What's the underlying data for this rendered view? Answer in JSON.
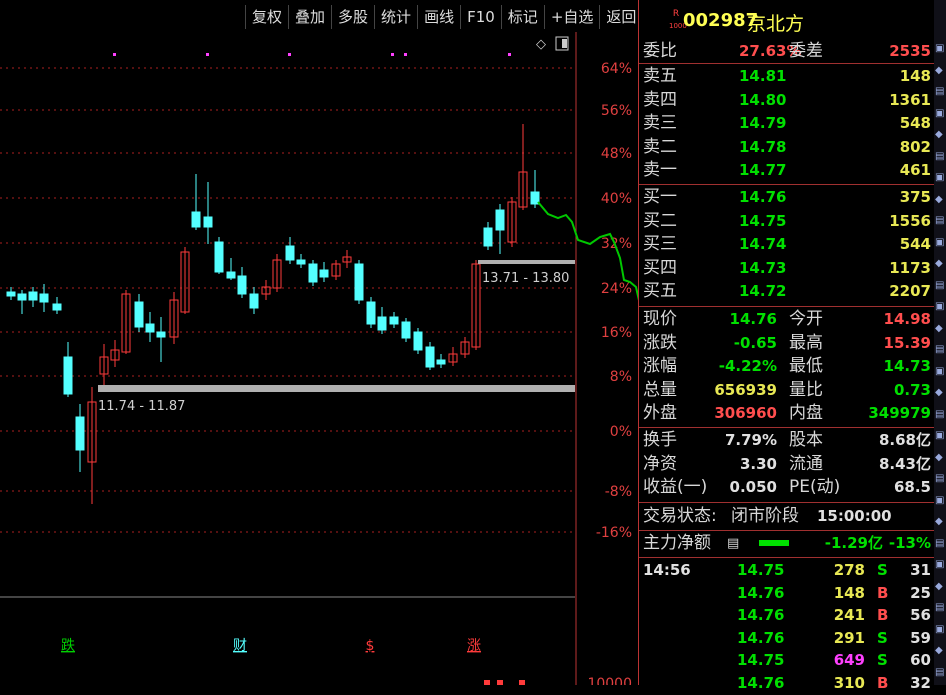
{
  "toolbar": [
    "复权",
    "叠加",
    "多股",
    "统计",
    "画线",
    "F10",
    "标记",
    "+自选",
    "返回"
  ],
  "stock": {
    "code": "002987",
    "name": "京北方",
    "logo": "R",
    "logo_sub": "1000"
  },
  "weibi": {
    "label": "委比",
    "value": "27.63%",
    "label2": "委差",
    "value2": "2535"
  },
  "sell": [
    {
      "label": "卖五",
      "price": "14.81",
      "vol": "148"
    },
    {
      "label": "卖四",
      "price": "14.80",
      "vol": "1361"
    },
    {
      "label": "卖三",
      "price": "14.79",
      "vol": "548"
    },
    {
      "label": "卖二",
      "price": "14.78",
      "vol": "802"
    },
    {
      "label": "卖一",
      "price": "14.77",
      "vol": "461"
    }
  ],
  "buy": [
    {
      "label": "买一",
      "price": "14.76",
      "vol": "375"
    },
    {
      "label": "买二",
      "price": "14.75",
      "vol": "1556"
    },
    {
      "label": "买三",
      "price": "14.74",
      "vol": "544"
    },
    {
      "label": "买四",
      "price": "14.73",
      "vol": "1173"
    },
    {
      "label": "买五",
      "price": "14.72",
      "vol": "2207"
    }
  ],
  "stats": [
    {
      "l1": "现价",
      "v1": "14.76",
      "l2": "今开",
      "v2": "14.98",
      "c1": "green",
      "c2": "red"
    },
    {
      "l1": "涨跌",
      "v1": "-0.65",
      "l2": "最高",
      "v2": "15.39",
      "c1": "green",
      "c2": "red"
    },
    {
      "l1": "涨幅",
      "v1": "-4.22%",
      "l2": "最低",
      "v2": "14.73",
      "c1": "green",
      "c2": "green"
    },
    {
      "l1": "总量",
      "v1": "656939",
      "l2": "量比",
      "v2": "0.73",
      "c1": "yellow",
      "c2": "green"
    },
    {
      "l1": "外盘",
      "v1": "306960",
      "l2": "内盘",
      "v2": "349979",
      "c1": "red",
      "c2": "green"
    }
  ],
  "fin": [
    {
      "l1": "换手",
      "v1": "7.79%",
      "l2": "股本",
      "v2": "8.68亿"
    },
    {
      "l1": "净资",
      "v1": "3.30",
      "l2": "流通",
      "v2": "8.43亿"
    },
    {
      "l1": "收益(一)",
      "v1": "0.050",
      "l2": "PE(动)",
      "v2": "68.5"
    }
  ],
  "trade_status": {
    "label": "交易状态:",
    "value": "闭市阶段",
    "time": "15:00:00"
  },
  "main_flow": {
    "label": "主力净额",
    "value": "-1.29亿",
    "pct": "-13%"
  },
  "ticks": [
    {
      "time": "14:56",
      "price": "14.75",
      "vol": "278",
      "bs": "S",
      "n": "31"
    },
    {
      "time": "",
      "price": "14.76",
      "vol": "148",
      "bs": "B",
      "n": "25"
    },
    {
      "time": "",
      "price": "14.76",
      "vol": "241",
      "bs": "B",
      "n": "56"
    },
    {
      "time": "",
      "price": "14.76",
      "vol": "291",
      "bs": "S",
      "n": "59"
    },
    {
      "time": "",
      "price": "14.75",
      "vol": "649",
      "bs": "S",
      "n": "60"
    },
    {
      "time": "",
      "price": "14.76",
      "vol": "310",
      "bs": "B",
      "n": "32"
    }
  ],
  "chart_data": {
    "type": "candlestick",
    "y_axis_percent_labels": [
      "64%",
      "56%",
      "48%",
      "40%",
      "32%",
      "24%",
      "16%",
      "8%",
      "0%",
      "-8%",
      "-16%"
    ],
    "y_axis_bottom": "10000",
    "range_labels": [
      "11.74 - 11.87",
      "13.71 - 13.80"
    ],
    "event_markers": [
      "跌",
      "财",
      "$",
      "涨"
    ],
    "colors": {
      "up": "#ff3b3b",
      "down": "#54ffff",
      "line": "#00c800",
      "grid": "#aa2020"
    }
  }
}
